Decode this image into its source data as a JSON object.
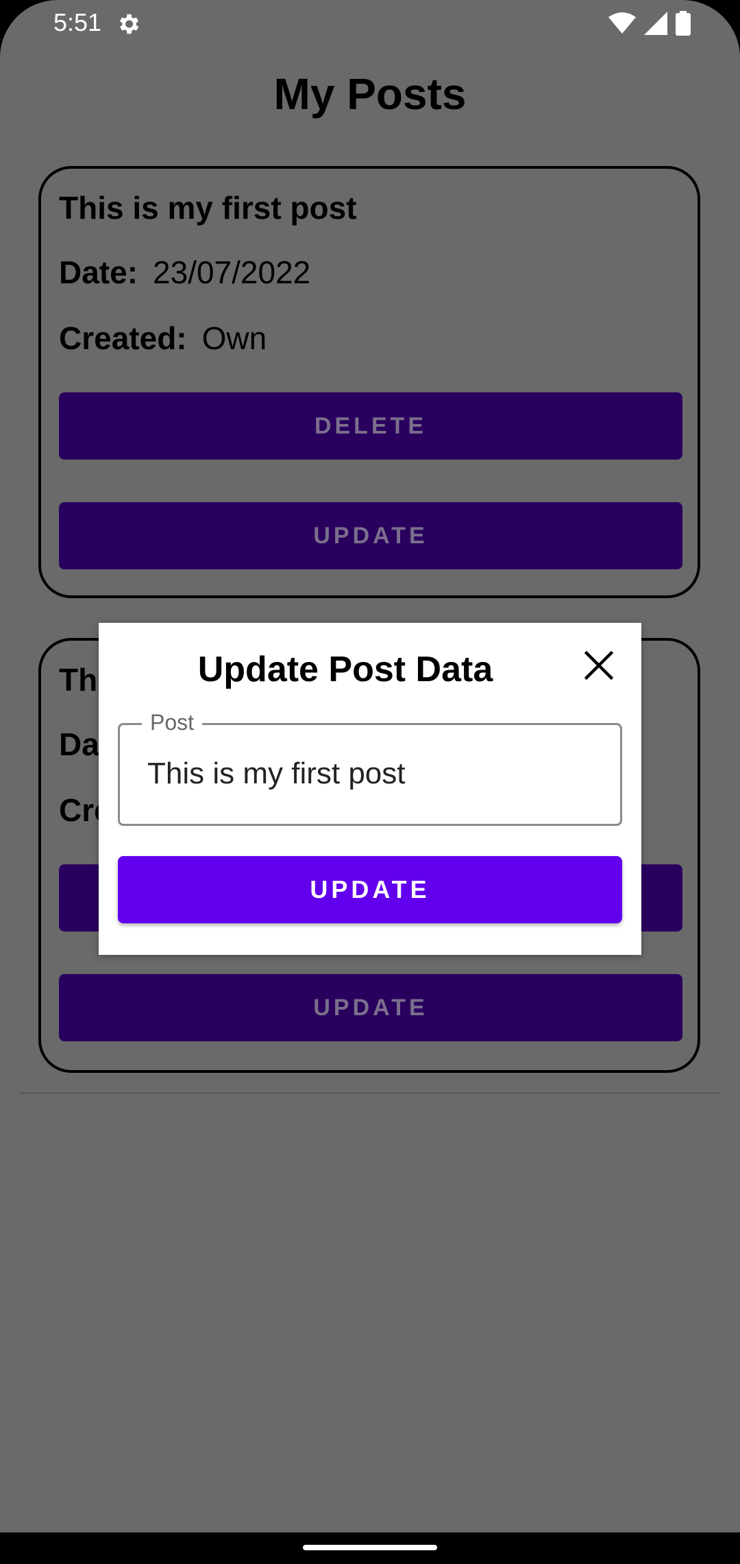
{
  "status_bar": {
    "time": "5:51",
    "icons": [
      "gear-icon",
      "wifi-icon",
      "signal-icon",
      "battery-icon"
    ]
  },
  "page": {
    "title": "My Posts"
  },
  "posts": [
    {
      "title": "This is my first post",
      "date_label": "Date:",
      "date_value": "23/07/2022",
      "created_label": "Created:",
      "created_value": "Own",
      "delete_label": "DELETE",
      "update_label": "UPDATE"
    },
    {
      "title": "Th",
      "date_label": "Da",
      "created_label": "Cre",
      "update_label": "UPDATE"
    }
  ],
  "dialog": {
    "title": "Update Post Data",
    "field_label": "Post",
    "field_value": "This is my first post",
    "update_label": "UPDATE"
  },
  "colors": {
    "scrim_background": "#6a6a6a",
    "card_button_dimmed": "#29005e",
    "primary": "#6200ee"
  }
}
